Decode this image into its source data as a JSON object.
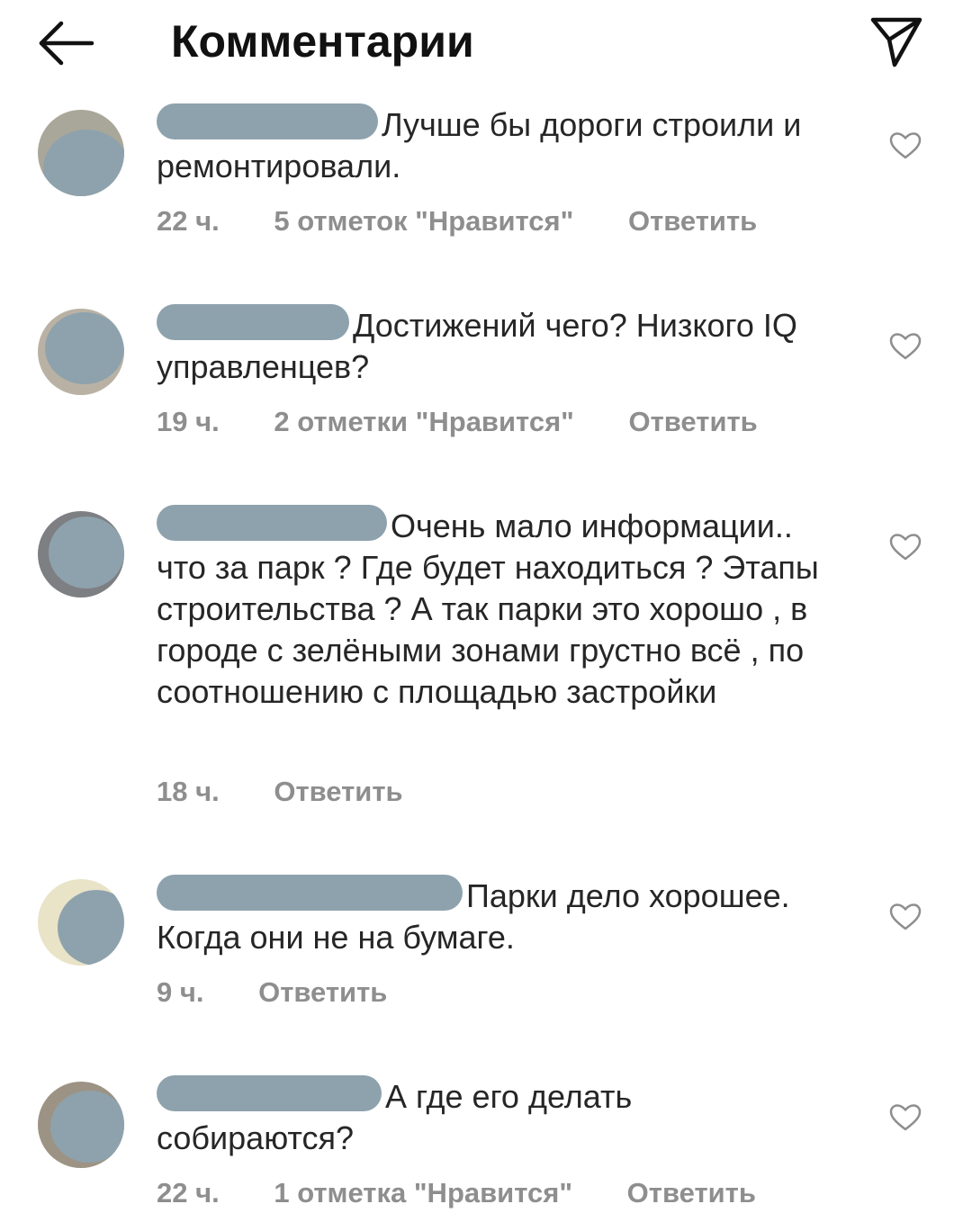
{
  "header": {
    "title": "Комментарии"
  },
  "comments": [
    {
      "text": "Лучше бы дороги строили и ремонтировали.",
      "time": "22 ч.",
      "likes": "5 отметок \"Нравится\"",
      "reply": "Ответить"
    },
    {
      "text": "Достижений чего? Низкого IQ управленцев?",
      "time": "19 ч.",
      "likes": "2 отметки \"Нравится\"",
      "reply": "Ответить"
    },
    {
      "text": "Очень мало информации.. что за парк ? Где будет находиться ? Этапы строительства ? А так парки это хорошо , в городе с зелёными зонами грустно всё , по соотношению с площадью застройки",
      "time": "18 ч.",
      "reply": "Ответить"
    },
    {
      "text": "Парки дело хорошее. Когда они не на бумаге.",
      "time": "9 ч.",
      "reply": "Ответить"
    },
    {
      "text": "А где его делать собираются?",
      "time": "22 ч.",
      "likes": "1 отметка \"Нравится\"",
      "reply": "Ответить"
    }
  ],
  "icons": {
    "back": "arrow-left-icon",
    "send": "paper-plane-icon",
    "like": "heart-outline-icon"
  },
  "colors": {
    "text": "#262626",
    "meta": "#8e8e8e",
    "redaction": "#8ea2ad"
  }
}
